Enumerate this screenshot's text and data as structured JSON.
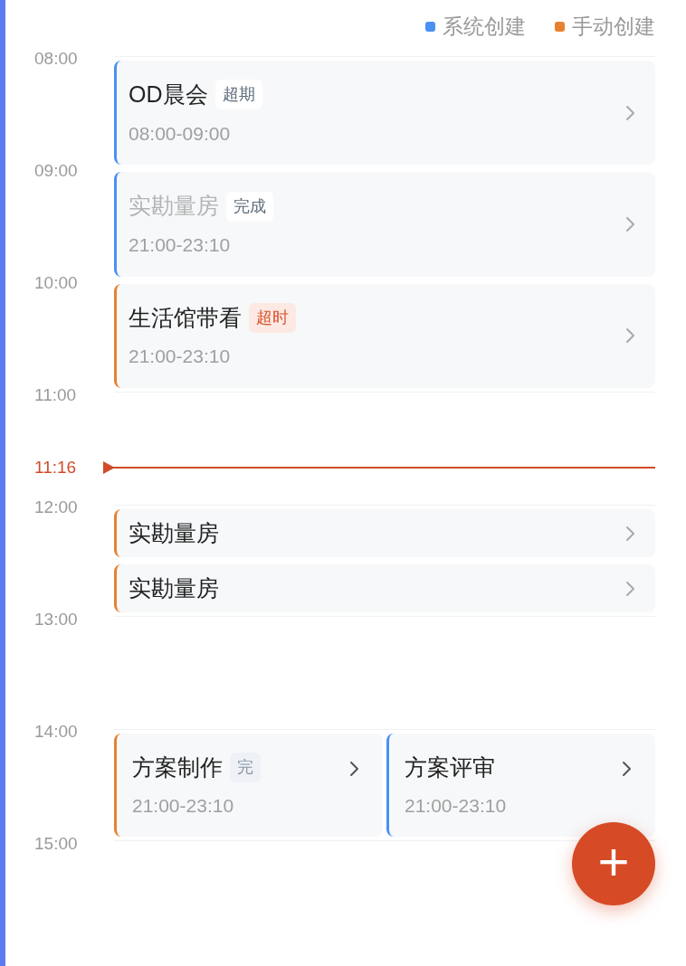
{
  "legend": [
    {
      "label": "系统创建",
      "color": "#4a90f5"
    },
    {
      "label": "手动创建",
      "color": "#e8812f"
    }
  ],
  "hours": [
    "08:00",
    "09:00",
    "10:00",
    "11:00",
    "12:00",
    "13:00",
    "14:00",
    "15:00"
  ],
  "now": {
    "time": "11:16"
  },
  "event_blocks": [
    {
      "kind": "stack",
      "events": [
        {
          "kind": "full",
          "title": "OD晨会",
          "tag": {
            "label": "超期",
            "kind": "plain"
          },
          "time": "08:00-09:00",
          "color": "#4a90f5",
          "completed": false
        },
        {
          "kind": "full",
          "title": "实勘量房",
          "tag": {
            "label": "完成",
            "kind": "plain"
          },
          "time": "21:00-23:10",
          "color": "#4a90f5",
          "completed": true
        },
        {
          "kind": "full",
          "title": "生活馆带看",
          "tag": {
            "label": "超时",
            "kind": "alert"
          },
          "time": "21:00-23:10",
          "color": "#e8812f",
          "completed": false
        }
      ]
    },
    {
      "kind": "stack",
      "events": [
        {
          "kind": "compact",
          "title": "实勘量房",
          "color": "#e8812f",
          "completed": false
        },
        {
          "kind": "compact",
          "title": "实勘量房",
          "color": "#e8812f",
          "completed": false
        }
      ]
    },
    {
      "kind": "side",
      "events": [
        {
          "kind": "full",
          "title": "方案制作",
          "tag": {
            "label": "完",
            "kind": "muted"
          },
          "time": "21:00-23:10",
          "color": "#e8812f",
          "completed": false
        },
        {
          "kind": "full",
          "title": "方案评审",
          "time": "21:00-23:10",
          "color": "#4a90f5",
          "completed": false
        }
      ]
    }
  ],
  "add_button": {
    "label": "+"
  }
}
